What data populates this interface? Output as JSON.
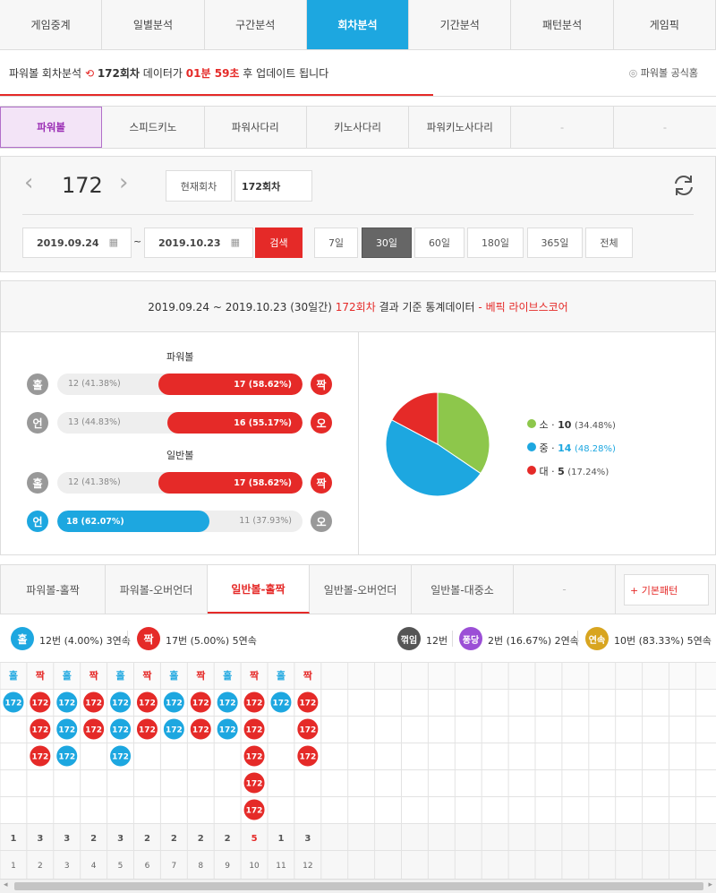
{
  "top_tabs": [
    "게임중계",
    "일별분석",
    "구간분석",
    "회차분석",
    "기간분석",
    "패턴분석",
    "게임픽"
  ],
  "top_active": 3,
  "info": {
    "game": "파워볼 회차분석",
    "round": "172회차",
    "mid": "데이터가",
    "timer": "01분 59초",
    "tail": "후 업데이트 됩니다",
    "link": "파워볼 공식홈"
  },
  "game_tabs": [
    "파워볼",
    "스피드키노",
    "파워사다리",
    "키노사다리",
    "파워키노사다리",
    "-",
    "-"
  ],
  "game_active": 0,
  "controls": {
    "round": "172",
    "prev": "‹",
    "next": "›",
    "current_btn": "현재회차",
    "round_input": "172회차",
    "date_from": "2019.09.24",
    "date_to": "2019.10.23",
    "tilde": "~",
    "search": "검색",
    "periods": [
      "7일",
      "30일",
      "60일",
      "180일",
      "365일",
      "전체"
    ],
    "period_active": 1
  },
  "stats": {
    "header": {
      "range": "2019.09.24 ~ 2019.10.23 (30일간)",
      "round": "172회차",
      "mid": "결과 기준 통계데이터",
      "brand": "- 베픽 라이브스코어"
    },
    "pb_title": "파워볼",
    "nb_title": "일반볼",
    "rows": [
      {
        "l": "홀",
        "lv": "12 (41.38%)",
        "rv": "17 (58.62%)",
        "r": "짝",
        "frac": 0.5862,
        "side": "right"
      },
      {
        "l": "언",
        "lv": "13 (44.83%)",
        "rv": "16 (55.17%)",
        "r": "오",
        "frac": 0.5517,
        "side": "right"
      },
      {
        "l": "홀",
        "lv": "12 (41.38%)",
        "rv": "17 (58.62%)",
        "r": "짝",
        "frac": 0.5862,
        "side": "right"
      },
      {
        "l": "언",
        "lv": "18 (62.07%)",
        "rv": "11 (37.93%)",
        "r": "오",
        "frac": 0.6207,
        "side": "left"
      }
    ],
    "pie": [
      {
        "name": "소",
        "count": "10",
        "pct": "(34.48%)",
        "value": 34.48,
        "color": "#8dc74b"
      },
      {
        "name": "중",
        "count": "14",
        "pct": "(48.28%)",
        "value": 48.28,
        "color": "#1da7e0"
      },
      {
        "name": "대",
        "count": "5",
        "pct": "(17.24%)",
        "value": 17.24,
        "color": "#e52a28"
      }
    ]
  },
  "pattern_tabs": [
    "파워볼-홀짝",
    "파워볼-오버언더",
    "일반볼-홀짝",
    "일반볼-오버언더",
    "일반볼-대중소",
    "-"
  ],
  "pattern_active": 2,
  "pattern_btn": "+ 기본패턴",
  "legend": {
    "odd": {
      "c": "홀",
      "t": "12번 (4.00%) 3연속"
    },
    "even": {
      "c": "짝",
      "t": "17번 (5.00%) 5연속"
    },
    "break": {
      "c": "꺾임",
      "t": "12번"
    },
    "pong": {
      "c": "퐁당",
      "t": "2번 (16.67%) 2연속"
    },
    "streak": {
      "c": "연속",
      "t": "10번 (83.33%) 5연속"
    }
  },
  "grid": {
    "columns": [
      {
        "h": "홀",
        "n": 1,
        "total": "1",
        "idx": "1"
      },
      {
        "h": "짝",
        "n": 3,
        "total": "3",
        "idx": "2"
      },
      {
        "h": "홀",
        "n": 3,
        "total": "3",
        "idx": "3"
      },
      {
        "h": "짝",
        "n": 2,
        "total": "2",
        "idx": "4"
      },
      {
        "h": "홀",
        "n": 3,
        "total": "3",
        "idx": "5"
      },
      {
        "h": "짝",
        "n": 2,
        "total": "2",
        "idx": "6"
      },
      {
        "h": "홀",
        "n": 2,
        "total": "2",
        "idx": "7"
      },
      {
        "h": "짝",
        "n": 2,
        "total": "2",
        "idx": "8"
      },
      {
        "h": "홀",
        "n": 2,
        "total": "2",
        "idx": "9"
      },
      {
        "h": "짝",
        "n": 5,
        "total": "5",
        "idx": "10"
      },
      {
        "h": "홀",
        "n": 1,
        "total": "1",
        "idx": "11"
      },
      {
        "h": "짝",
        "n": 3,
        "total": "3",
        "idx": "12"
      }
    ],
    "ball_label": "172",
    "max_index": "5"
  },
  "colors": {
    "accent": "#1da7e0",
    "red": "#e52a28",
    "purple": "#9b2fb5"
  }
}
